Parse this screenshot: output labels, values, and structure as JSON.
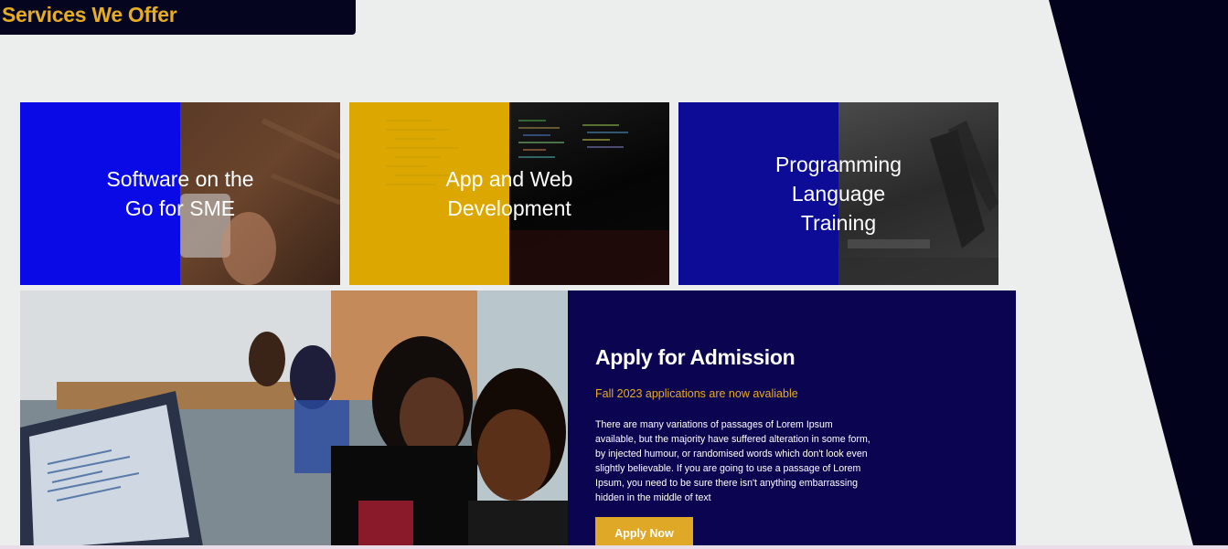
{
  "section": {
    "title": "Services We Offer"
  },
  "services": [
    {
      "label": "Software on the Go for SME"
    },
    {
      "label": "App and Web Development"
    },
    {
      "label": "Programming Language Training"
    }
  ],
  "admission": {
    "title": "Apply for Admission",
    "subtitle": "Fall 2023 applications are now avaliable",
    "body": "There are many variations of passages of Lorem Ipsum available, but the majority have suffered alteration in some form, by injected humour, or randomised words which don't look even slightly believable. If you are going to use a passage of Lorem Ipsum, you need to be sure there isn't anything embarrassing hidden in the middle of text",
    "button_label": "Apply Now"
  },
  "colors": {
    "accent": "#e6ac22",
    "navy": "#0b0450",
    "dark": "#05051f",
    "blue": "#0a0ae6",
    "gold": "#dca800"
  }
}
